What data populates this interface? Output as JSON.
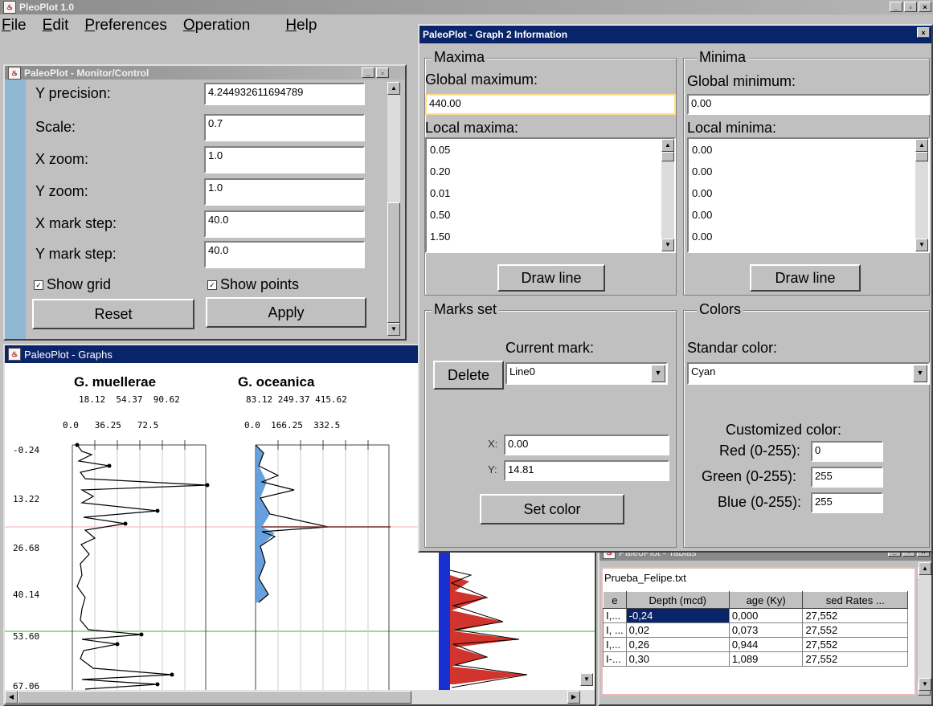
{
  "app": {
    "title": "PleoPlot 1.0",
    "menu": [
      "File",
      "Edit",
      "Preferences",
      "Operation",
      "Help"
    ]
  },
  "monitor": {
    "title": "PaleoPlot - Monitor/Control",
    "rows": [
      {
        "label": "Y precision:",
        "value": "4.244932611694789"
      },
      {
        "label": "Scale:",
        "value": "0.7"
      },
      {
        "label": "X zoom:",
        "value": "1.0"
      },
      {
        "label": "Y zoom:",
        "value": "1.0"
      },
      {
        "label": "X mark step:",
        "value": "40.0"
      },
      {
        "label": "Y mark step:",
        "value": "40.0"
      }
    ],
    "show_grid": "Show grid",
    "show_points": "Show points",
    "reset": "Reset",
    "apply": "Apply"
  },
  "graphs": {
    "title": "PaleoPlot - Graphs",
    "panel1": {
      "name": "G. muellerae",
      "scale_top": "18.12  54.37  90.62",
      "scale_bottom": "0.0   36.25   72.5"
    },
    "panel2": {
      "name": "G. oceanica",
      "scale_top": "83.12 249.37 415.62",
      "scale_bottom": "0.0  166.25  332.5"
    },
    "depth_ticks": [
      "-0.24",
      "13.22",
      "26.68",
      "40.14",
      "53.60",
      "67.06"
    ]
  },
  "info": {
    "title": "PaleoPlot - Graph 2 Information",
    "maxima": {
      "group": "Maxima",
      "global_label": "Global maximum:",
      "global_value": "440.00",
      "local_label": "Local maxima:",
      "local_values": [
        "0.05",
        "0.20",
        "0.01",
        "0.50",
        "1.50"
      ],
      "draw_line": "Draw line"
    },
    "minima": {
      "group": "Minima",
      "global_label": "Global minimum:",
      "global_value": "0.00",
      "local_label": "Local minima:",
      "local_values": [
        "0.00",
        "0.00",
        "0.00",
        "0.00",
        "0.00"
      ],
      "draw_line": "Draw line"
    },
    "marks": {
      "group": "Marks set",
      "current_label": "Current mark:",
      "delete": "Delete",
      "current_value": "Line0",
      "x_label": "X:",
      "x_value": "0.00",
      "y_label": "Y:",
      "y_value": "14.81",
      "set_color": "Set color"
    },
    "colors": {
      "group": "Colors",
      "standar_label": "Standar color:",
      "standar_value": "Cyan",
      "customized_label": "Customized color:",
      "red_label": "Red (0-255):",
      "red_value": "0",
      "green_label": "Green (0-255):",
      "green_value": "255",
      "blue_label": "Blue (0-255):",
      "blue_value": "255"
    }
  },
  "tablas": {
    "title": "PaleoPlot - Tablas",
    "file": "Prueba_Felipe.txt",
    "columns": [
      "e",
      "Depth (mcd)",
      "age (Ky)",
      "sed Rates ..."
    ],
    "rows": [
      [
        "I,...",
        "-0,24",
        "0,000",
        "27,552"
      ],
      [
        "I, ...",
        "0,02",
        "0,073",
        "27,552"
      ],
      [
        "I,...",
        "0,26",
        "0,944",
        "27,552"
      ],
      [
        "I-...",
        "0,30",
        "1,089",
        "27,552"
      ]
    ]
  }
}
